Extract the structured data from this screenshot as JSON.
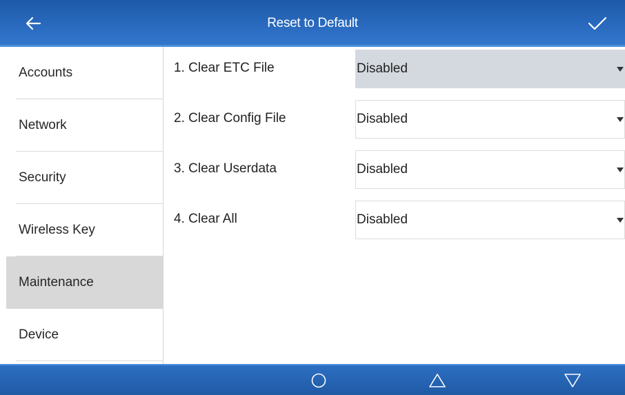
{
  "header": {
    "title": "Reset to Default",
    "back_icon": "arrow-left-icon",
    "confirm_icon": "checkmark-icon",
    "color": "#2a6bc0"
  },
  "sidebar": {
    "items": [
      {
        "label": "Accounts",
        "active": false
      },
      {
        "label": "Network",
        "active": false
      },
      {
        "label": "Security",
        "active": false
      },
      {
        "label": "Wireless Key",
        "active": false
      },
      {
        "label": "Maintenance",
        "active": true
      },
      {
        "label": "Device",
        "active": false
      }
    ]
  },
  "settings": [
    {
      "label": "1. Clear ETC File",
      "value": "Disabled",
      "focused": true
    },
    {
      "label": "2. Clear Config File",
      "value": "Disabled",
      "focused": false
    },
    {
      "label": "3. Clear Userdata",
      "value": "Disabled",
      "focused": false
    },
    {
      "label": "4. Clear All",
      "value": "Disabled",
      "focused": false
    }
  ],
  "navbar": {
    "buttons": [
      "home-circle-icon",
      "up-triangle-icon",
      "down-triangle-icon"
    ],
    "color": "#1f5aa5"
  }
}
